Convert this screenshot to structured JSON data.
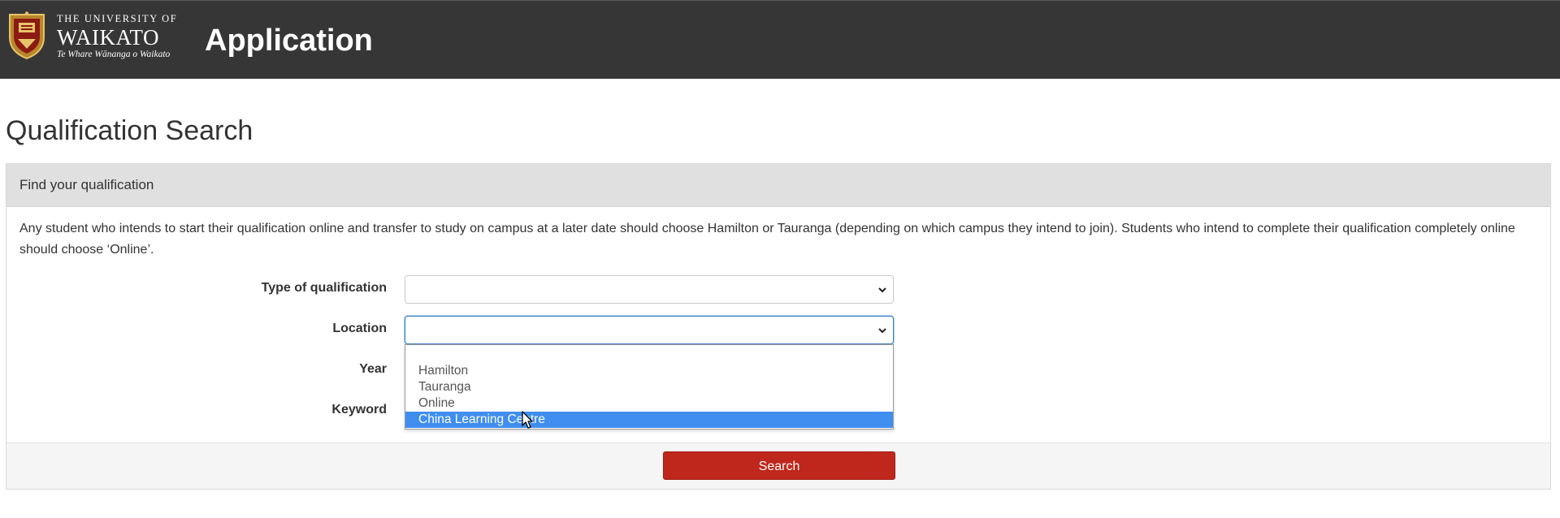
{
  "header": {
    "logo": {
      "line1": "THE UNIVERSITY OF",
      "line2": "WAIKATO",
      "line3": "Te Whare Wānanga o Waikato"
    },
    "app_title": "Application",
    "background_color": "#363636"
  },
  "page": {
    "title": "Qualification Search"
  },
  "panel": {
    "heading": "Find your qualification",
    "note": "Any student who intends to start their qualification online and transfer to study on campus at a later date should choose Hamilton or Tauranga (depending on which campus they intend to join). Students who intend to complete their qualification completely online should choose ‘Online’.",
    "fields": {
      "type_label": "Type of qualification",
      "type_value": "",
      "location_label": "Location",
      "location_value": "",
      "year_label": "Year",
      "keyword_label": "Keyword"
    },
    "location_options": [
      "",
      "Hamilton",
      "Tauranga",
      "Online",
      "China Learning Centre"
    ],
    "location_highlighted": "China Learning Centre",
    "search_label": "Search"
  },
  "colors": {
    "accent_button": "#c0271c",
    "dropdown_highlight": "#3f8ef0",
    "focus_border": "#3b82c4"
  },
  "icons": {
    "logo": "university-crest-icon",
    "select_arrow": "chevron-down-icon",
    "cursor": "mouse-pointer-icon"
  }
}
